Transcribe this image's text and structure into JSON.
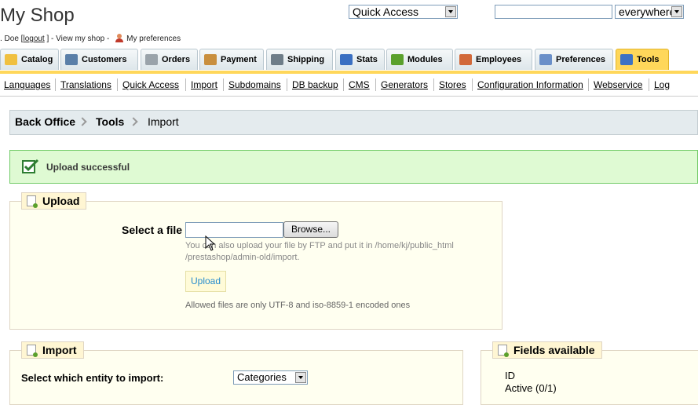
{
  "header": {
    "title": "My Shop",
    "quick_access": "Quick Access",
    "search_value": "",
    "search_scope": "everywhere"
  },
  "userline": {
    "name_fragment": ". Doe [",
    "logout": "logout",
    "sep": "] -",
    "view_shop": "View my shop",
    "dash": "-",
    "preferences": "My preferences"
  },
  "tabs": [
    {
      "label": "Catalog",
      "color": "#f0c040"
    },
    {
      "label": "Customers",
      "color": "#5a7fa8"
    },
    {
      "label": "Orders",
      "color": "#9aa3aa"
    },
    {
      "label": "Payment",
      "color": "#c98f3e"
    },
    {
      "label": "Shipping",
      "color": "#6e7d88"
    },
    {
      "label": "Stats",
      "color": "#3a6fc2"
    },
    {
      "label": "Modules",
      "color": "#5aa02c"
    },
    {
      "label": "Employees",
      "color": "#d2693a"
    },
    {
      "label": "Preferences",
      "color": "#6a8fc8"
    },
    {
      "label": "Tools",
      "color": "#3d72c4"
    }
  ],
  "subnav": [
    "Languages",
    "Translations",
    "Quick Access",
    "Import",
    "Subdomains",
    "DB backup",
    "CMS",
    "Generators",
    "Stores",
    "Configuration Information",
    "Webservice",
    "Log"
  ],
  "breadcrumb": {
    "root": "Back Office",
    "section": "Tools",
    "current": "Import"
  },
  "alert": {
    "message": "Upload successful"
  },
  "upload": {
    "legend": "Upload",
    "select_label": "Select a file",
    "browse": "Browse...",
    "hint1": "You can also upload your file by FTP and put it in /home/kj/public_html",
    "hint2": "/prestashop/admin-old/import.",
    "button": "Upload",
    "allowed": "Allowed files are only UTF-8 and iso-8859-1 encoded ones"
  },
  "import": {
    "legend": "Import",
    "entity_label": "Select which entity to import:",
    "entity_value": "Categories"
  },
  "fields": {
    "legend": "Fields available",
    "items": [
      "ID",
      "Active (0/1)"
    ]
  }
}
